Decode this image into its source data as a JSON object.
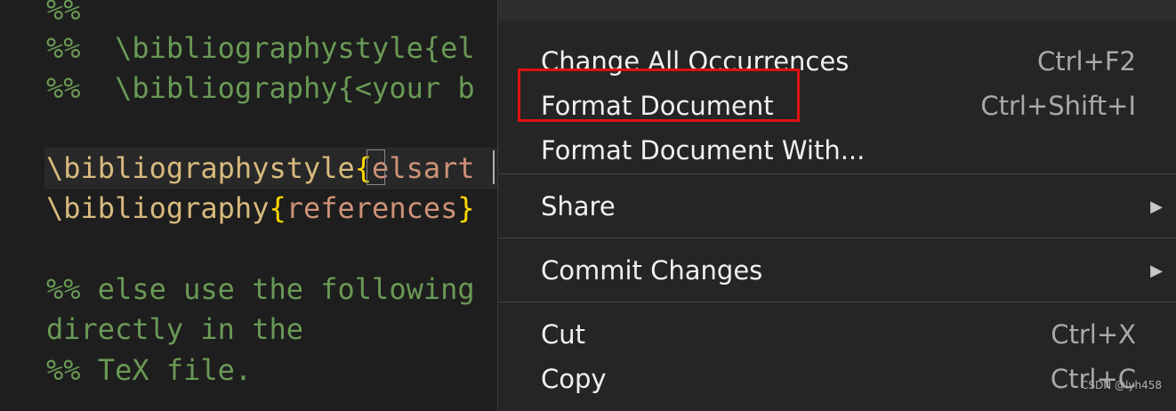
{
  "editor": {
    "lines": [
      {
        "tokens": [
          {
            "t": "%%",
            "c": "comment"
          }
        ]
      },
      {
        "tokens": [
          {
            "t": "%%  \\bibliographystyle{el",
            "c": "comment"
          }
        ]
      },
      {
        "tokens": [
          {
            "t": "%%  \\bibliography{<your b",
            "c": "comment"
          }
        ]
      },
      {
        "tokens": []
      },
      {
        "tokens": [
          {
            "t": "\\bibliographystyle",
            "c": "cmd"
          },
          {
            "t": "{",
            "c": "brace"
          },
          {
            "t": "elsart",
            "c": "arg"
          }
        ]
      },
      {
        "tokens": [
          {
            "t": "\\bibliography",
            "c": "cmd"
          },
          {
            "t": "{",
            "c": "brace"
          },
          {
            "t": "references",
            "c": "arg"
          },
          {
            "t": "}",
            "c": "brace"
          }
        ]
      },
      {
        "tokens": []
      },
      {
        "tokens": [
          {
            "t": "%% else use the following",
            "c": "comment"
          }
        ]
      },
      {
        "tokens": [
          {
            "t": "directly in the",
            "c": "comment"
          }
        ]
      },
      {
        "tokens": [
          {
            "t": "%% TeX file.",
            "c": "comment"
          }
        ]
      }
    ]
  },
  "context_menu": {
    "groups": [
      [
        {
          "label": "Change All Occurrences",
          "keybinding": "Ctrl+F2",
          "submenu": false
        },
        {
          "label": "Format Document",
          "keybinding": "Ctrl+Shift+I",
          "submenu": false,
          "highlighted": true
        },
        {
          "label": "Format Document With...",
          "keybinding": "",
          "submenu": false
        }
      ],
      [
        {
          "label": "Share",
          "keybinding": "",
          "submenu": true,
          "arrow": "▶"
        }
      ],
      [
        {
          "label": "Commit Changes",
          "keybinding": "",
          "submenu": true,
          "arrow": "▶"
        }
      ],
      [
        {
          "label": "Cut",
          "keybinding": "Ctrl+X",
          "submenu": false
        },
        {
          "label": "Copy",
          "keybinding": "Ctrl+C",
          "submenu": false
        }
      ]
    ]
  },
  "watermark": "CSDN @lyh458",
  "colors": {
    "highlight_box": "#e21010",
    "comment": "#6a9955",
    "command": "#d7ba7d",
    "brace": "#ffd700",
    "argument": "#ce9178"
  }
}
